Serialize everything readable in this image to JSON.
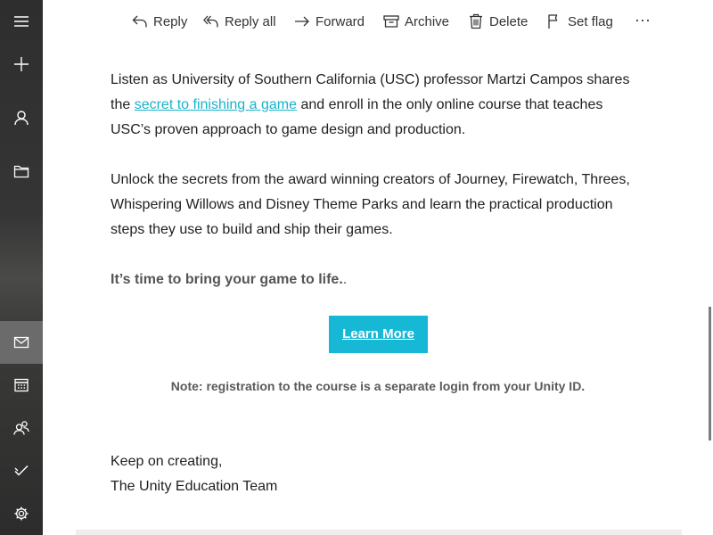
{
  "rail": {
    "items": [
      {
        "icon": "hamburger-menu-icon"
      },
      {
        "icon": "new-mail-plus-icon"
      },
      {
        "icon": "person-icon"
      },
      {
        "icon": "folder-icon"
      },
      {
        "icon": "mail-icon",
        "active": true
      },
      {
        "icon": "calendar-icon"
      },
      {
        "icon": "people-icon"
      },
      {
        "icon": "todo-check-icon"
      },
      {
        "icon": "gear-icon"
      }
    ],
    "active_color": "#6b6b6b"
  },
  "toolbar": {
    "reply": "Reply",
    "reply_all": "Reply all",
    "forward": "Forward",
    "archive": "Archive",
    "delete": "Delete",
    "set_flag": "Set flag",
    "more": "···"
  },
  "message": {
    "p1_before": "Listen as University of Southern California (USC) professor Martzi Campos shares the ",
    "p1_link": "secret to finishing a game",
    "p1_after": " and enroll in the only online course that teaches USC’s proven approach to game design and production.",
    "p2": "Unlock the secrets from the award winning creators of Journey, Firewatch, Threes, Whispering Willows and Disney Theme Parks and learn the practical production steps they use to build and ship their games.",
    "emphasis": "It’s time to bring your game to life.",
    "emphasis_trail": ".",
    "cta_label": "Learn More",
    "note": "Note: registration to the course is a separate login from your Unity ID.",
    "signoff_line1": "Keep on creating,",
    "signoff_line2": "The Unity Education Team"
  },
  "colors": {
    "link": "#17b3c9",
    "cta_background": "#16b8d6",
    "cta_text": "#ffffff"
  }
}
